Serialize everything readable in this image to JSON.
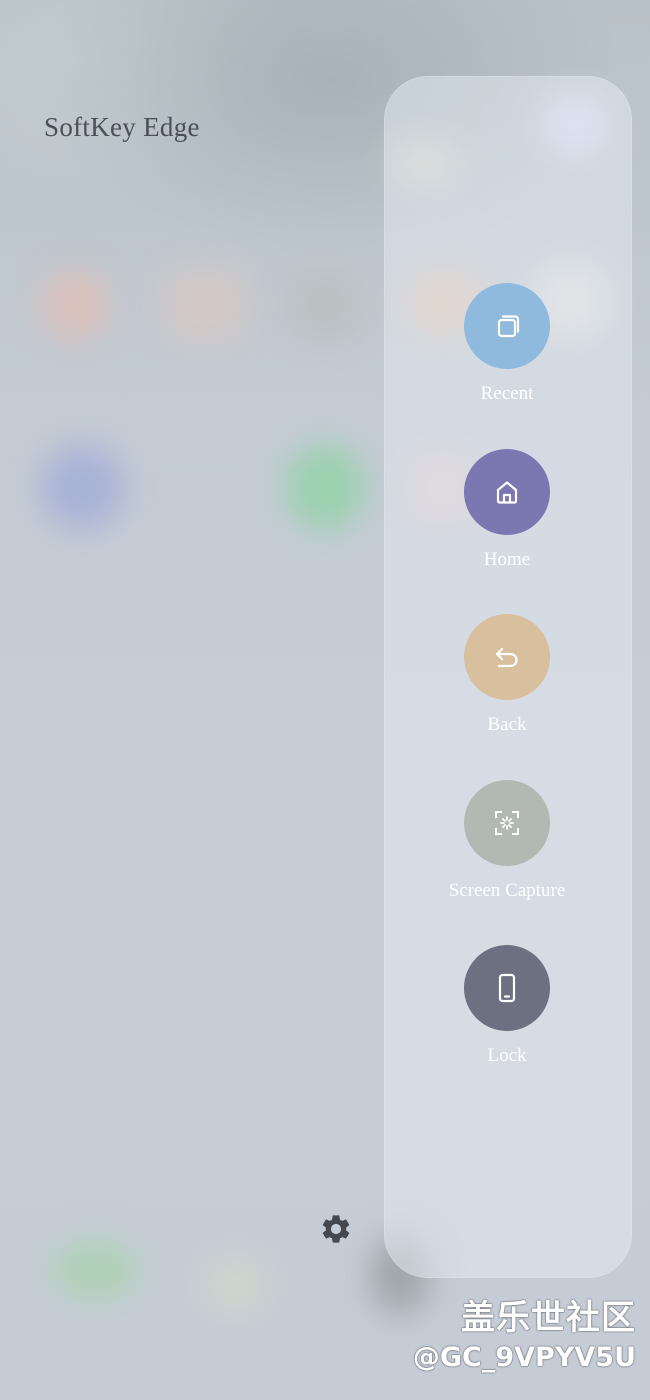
{
  "edge_panel": {
    "title": "SoftKey Edge",
    "keys": [
      {
        "label": "Recent",
        "icon": "recent-apps-icon",
        "color": "#8fbadd"
      },
      {
        "label": "Home",
        "icon": "home-icon",
        "color": "#7b77b0"
      },
      {
        "label": "Back",
        "icon": "back-arrow-icon",
        "color": "#d8bf9d"
      },
      {
        "label": "Screen Capture",
        "icon": "screen-capture-icon",
        "color": "#b2b8b2"
      },
      {
        "label": "Lock",
        "icon": "phone-lock-icon",
        "color": "#6c7080"
      }
    ],
    "settings_icon": "gear-icon"
  },
  "watermark": {
    "line1": "盖乐世社区",
    "line2": "@GC_9VPYV5U"
  }
}
